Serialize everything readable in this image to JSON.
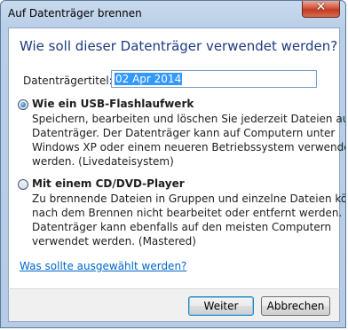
{
  "window": {
    "title": "Auf Datenträger brennen",
    "close_label": "✕"
  },
  "dialog": {
    "heading": "Wie soll dieser Datenträger verwendet werden?",
    "title_field": {
      "label": "Datenträgertitel:",
      "value": "02 Apr 2014"
    },
    "options": [
      {
        "label": "Wie ein USB-Flashlaufwerk",
        "selected": true,
        "description_lines": [
          "Speichern, bearbeiten und löschen Sie jederzeit Dateien auf dem",
          "Datenträger. Der Datenträger kann auf Computern unter",
          "Windows XP oder einem neueren Betriebssystem verwendet",
          "werden. (Livedateisystem)"
        ]
      },
      {
        "label": "Mit einem CD/DVD-Player",
        "selected": false,
        "description_lines": [
          "Zu brennende Dateien in Gruppen und einzelne Dateien können",
          "nach dem Brennen nicht bearbeitet oder entfernt werden. Der",
          "Datenträger kann ebenfalls auf den meisten Computern",
          "verwendet werden. (Mastered)"
        ]
      }
    ],
    "help_link": "Was sollte ausgewählt werden?"
  },
  "footer": {
    "next_label": "Weiter",
    "cancel_label": "Abbrechen"
  }
}
